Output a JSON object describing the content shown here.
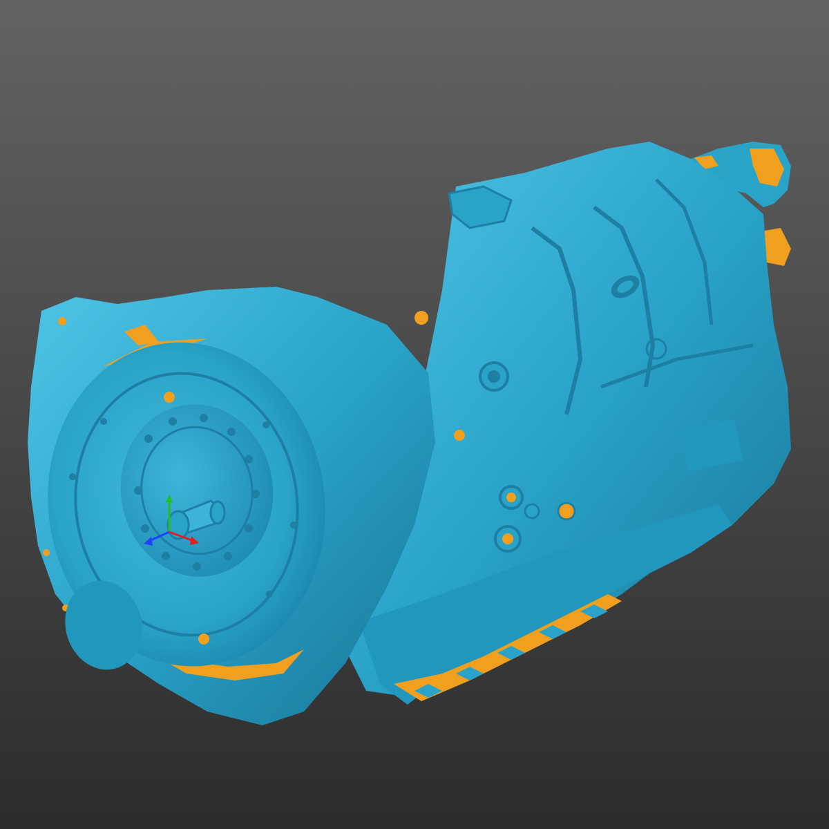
{
  "viewer": {
    "background_top": "#636363",
    "background_bottom": "#2c2c2c"
  },
  "model": {
    "name_icon": "transmission-scan-mesh",
    "surface_color": "#2aa3c9",
    "surface_shadow_color": "#1c7fa3",
    "surface_highlight_color": "#4fc4e6",
    "backface_color": "#f0a01e"
  },
  "axis_triad": {
    "icon": "xyz-axis-triad",
    "x_color": "#e02020",
    "y_color": "#20c020",
    "z_color": "#2040ff"
  }
}
